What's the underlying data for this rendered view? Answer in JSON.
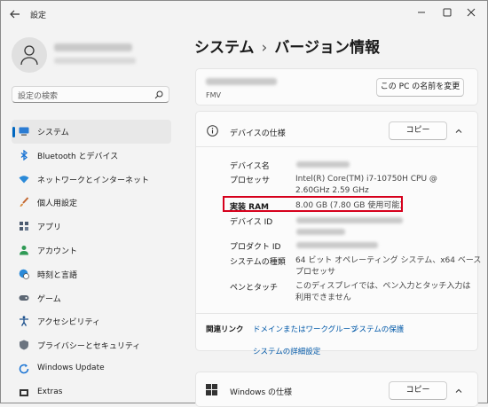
{
  "window": {
    "title": "設定"
  },
  "search": {
    "placeholder": "設定の検索"
  },
  "sidebar": {
    "items": [
      {
        "label": "システム",
        "icon": "monitor-icon",
        "active": true
      },
      {
        "label": "Bluetooth とデバイス",
        "icon": "bluetooth-icon"
      },
      {
        "label": "ネットワークとインターネット",
        "icon": "wifi-icon"
      },
      {
        "label": "個人用設定",
        "icon": "brush-icon"
      },
      {
        "label": "アプリ",
        "icon": "apps-icon"
      },
      {
        "label": "アカウント",
        "icon": "person-icon"
      },
      {
        "label": "時刻と言語",
        "icon": "globe-clock-icon"
      },
      {
        "label": "ゲーム",
        "icon": "gamepad-icon"
      },
      {
        "label": "アクセシビリティ",
        "icon": "accessibility-icon"
      },
      {
        "label": "プライバシーとセキュリティ",
        "icon": "shield-icon"
      },
      {
        "label": "Windows Update",
        "icon": "update-icon"
      },
      {
        "label": "Extras",
        "icon": "extras-icon"
      }
    ]
  },
  "breadcrumb": {
    "parent": "システム",
    "separator": "›",
    "current": "バージョン情報"
  },
  "device_card": {
    "subtitle": "FMV",
    "rename_button": "この PC の名前を変更"
  },
  "device_spec": {
    "title": "デバイスの仕様",
    "copy_button": "コピー",
    "rows": [
      {
        "label": "デバイス名",
        "value": ""
      },
      {
        "label": "プロセッサ",
        "value_line1": "Intel(R) Core(TM) i7-10750H CPU @",
        "value_line2": "2.60GHz   2.59 GHz"
      },
      {
        "label": "実装 RAM",
        "value": "8.00 GB (7.80 GB 使用可能)"
      },
      {
        "label": "デバイス ID",
        "value": ""
      },
      {
        "label": "プロダクト ID",
        "value": ""
      },
      {
        "label": "システムの種類",
        "value_line1": "64 ビット オペレーティング システム、x64 ベース",
        "value_line2": "プロセッサ"
      },
      {
        "label": "ペンとタッチ",
        "value_line1": "このディスプレイでは、ペン入力とタッチ入力は",
        "value_line2": "利用できません"
      }
    ]
  },
  "related_links": {
    "label": "関連リンク",
    "links": [
      "ドメインまたはワークグループ",
      "システムの保護",
      "システムの詳細設定"
    ]
  },
  "windows_spec": {
    "title": "Windows の仕様",
    "copy_button": "コピー"
  },
  "colors": {
    "accent": "#0067c0",
    "highlight_border": "#d6001c",
    "link": "#0058a8"
  }
}
